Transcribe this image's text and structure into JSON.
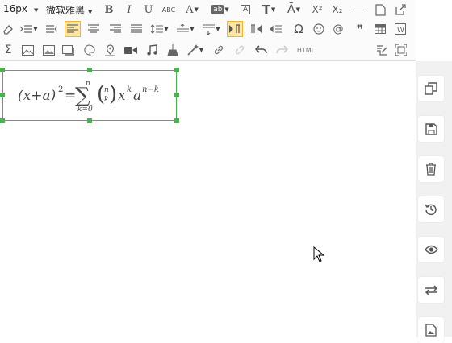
{
  "toolbar": {
    "font_size": "16px",
    "font_family": "微软雅黑",
    "row1_icons": [
      "bold-icon",
      "italic-icon",
      "underline-icon",
      "strikethrough-icon",
      "font-color-icon",
      "highlight-icon",
      "border-text-icon",
      "text-style-icon",
      "text-transform-icon",
      "superscript-icon",
      "subscript-icon",
      "horizontal-rule-icon",
      "new-document-icon",
      "external-edit-icon"
    ],
    "row2_icons": [
      "eraser-icon",
      "indent-icon",
      "outdent-icon",
      "align-left-icon",
      "align-center-icon",
      "align-right-icon",
      "justify-icon",
      "line-height-icon",
      "paragraph-spacing-icon",
      "row-spacing-icon",
      "ltr-icon",
      "rtl-icon",
      "text-direction-icon",
      "special-char-icon",
      "emoji-icon",
      "at-icon",
      "quote-icon",
      "table-icon",
      "word-icon"
    ],
    "row3_icons": [
      "formula-icon",
      "image-icon",
      "image-gallery-icon",
      "frame-icon",
      "draw-icon",
      "map-icon",
      "video-icon",
      "music-icon",
      "broom-icon",
      "magic-icon",
      "link-icon",
      "unlink-icon",
      "undo-icon",
      "redo-icon",
      "html-icon",
      "edit-icon",
      "fullscreen-icon"
    ],
    "html_label": "HTML",
    "bold_label": "B",
    "italic_label": "I",
    "underline_label": "U",
    "strike_label": "ABC",
    "font_color_label": "A",
    "highlight_label": "ab",
    "border_label": "A",
    "super_label": "X²",
    "sub_label": "X₂",
    "omega_label": "Ω",
    "sigma_label": "Σ",
    "quote_label": "❞",
    "at_label": "@"
  },
  "formula": {
    "left": "(x+a)",
    "exp": "2",
    "eq": "=",
    "sum_upper": "n",
    "sum_lower": "k=0",
    "binom_top": "n",
    "binom_bottom": "k",
    "x": "x",
    "x_exp": "k",
    "a": "a",
    "a_exp": "n−k"
  },
  "sidebar": {
    "buttons": [
      "copy-icon",
      "save-icon",
      "delete-icon",
      "history-icon",
      "preview-icon",
      "swap-icon",
      "image-icon"
    ]
  },
  "colors": {
    "accent": "#4caf50",
    "active_bg": "#ffe69f",
    "sidebar_bg": "#f1f1f1"
  }
}
